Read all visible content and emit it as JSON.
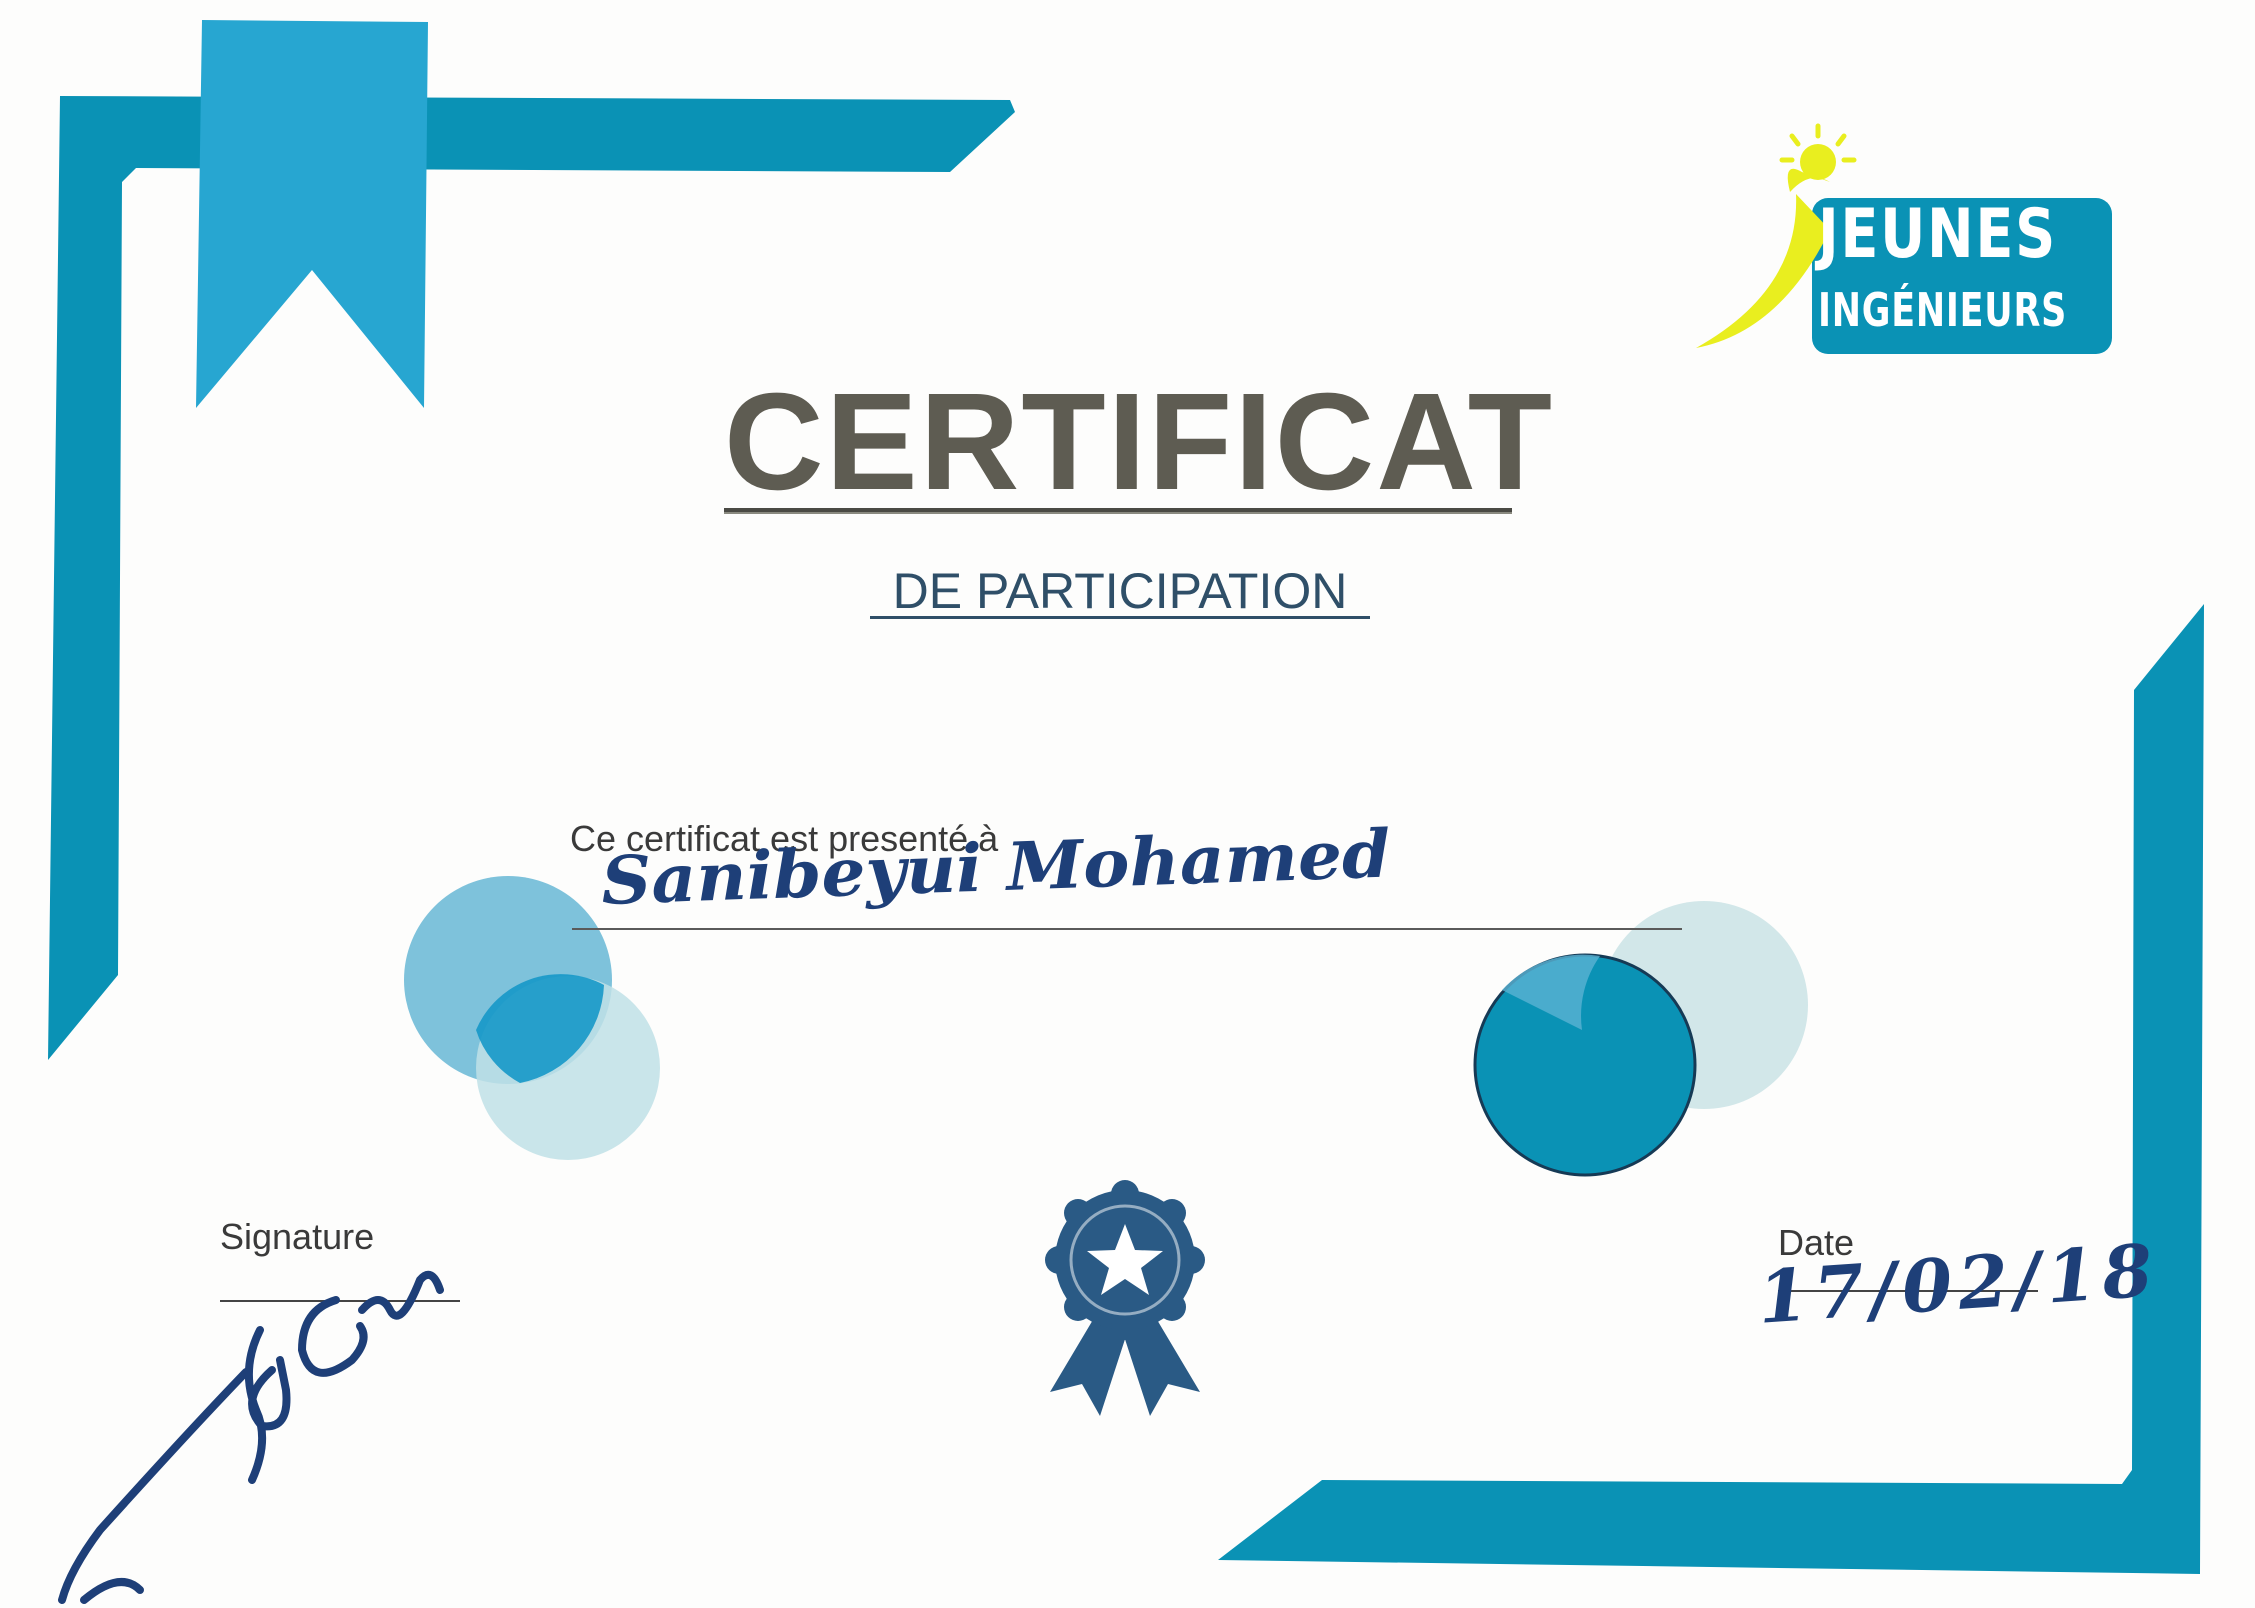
{
  "logo": {
    "line1": "JEUNES",
    "line2": "INGÉNIEURS"
  },
  "certificate": {
    "title": "CERTIFICAT",
    "subtitle": "DE PARTICIPATION",
    "presented_label": "Ce certificat est presenté à",
    "recipient_name": "Sanibeyui Mohamed",
    "signature_label": "Signature",
    "date_label": "Date",
    "date_value": "17/02/18"
  },
  "colors": {
    "primary_teal": "#0a92b5",
    "light_blue": "#27a6d1",
    "pale_blue": "#bfe0e6",
    "dark_navy": "#2a5a85",
    "title_gray": "#5e5c52",
    "sun_yellow": "#e9ee1f",
    "ink_blue": "#1e3f78"
  },
  "icons": {
    "badge": "award-ribbon-star-icon",
    "sun": "sun-icon"
  }
}
